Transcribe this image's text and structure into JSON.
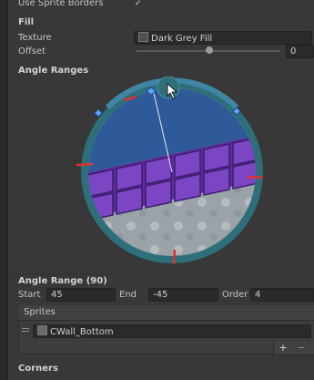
{
  "top_row": {
    "label": "Use Sprite Borders",
    "checked": true,
    "check_glyph": "✓"
  },
  "fill": {
    "section_title": "Fill",
    "texture_label": "Texture",
    "texture_value": "Dark Grey Fill",
    "offset_label": "Offset",
    "offset_value": "0",
    "offset_slider_fraction": 0.5
  },
  "angle_ranges": {
    "section_title": "Angle Ranges"
  },
  "angle_range": {
    "title": "Angle Range (90)",
    "start_label": "Start",
    "start_value": "45",
    "end_label": "End",
    "end_value": "-45",
    "order_label": "Order",
    "order_value": "4"
  },
  "sprites": {
    "header": "Sprites",
    "item_value": "CWall_Bottom",
    "add_glyph": "+",
    "remove_glyph": "−"
  },
  "corners": {
    "section_title": "Corners"
  },
  "icons": {
    "sprite_field_icon": "sprite-object-icon",
    "drag_handle": "drag-handle-icon",
    "pointer": "mouse-cursor-icon"
  },
  "colors": {
    "background": "#383838",
    "field_bg": "#2a2a2a",
    "circle_teal": "#2e6f7a",
    "sky_blue": "#2f5a9a",
    "brick_purple": "#6d3ab3",
    "ground_grey": "#9aa3a8",
    "range_marker_red": "#e0322c"
  }
}
